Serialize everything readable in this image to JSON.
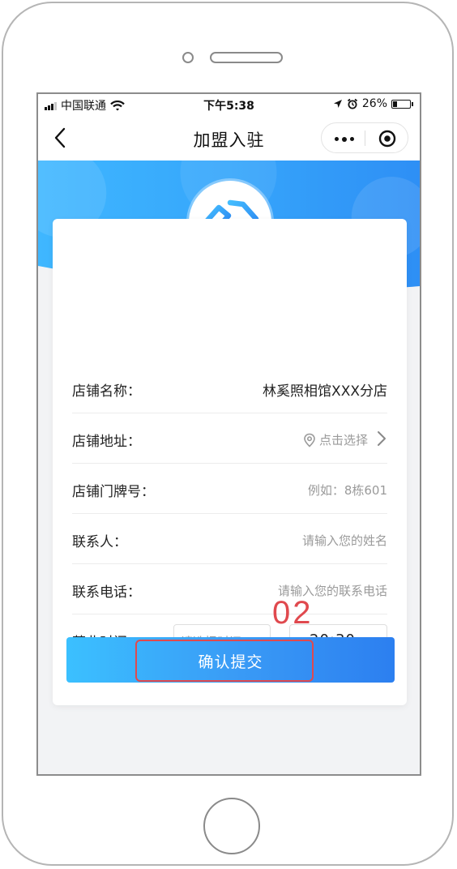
{
  "status_bar": {
    "carrier": "中国联通",
    "time": "下午5:38",
    "battery": "26%"
  },
  "nav": {
    "title": "加盟入驻"
  },
  "form": {
    "store_name": {
      "label": "店铺名称：",
      "value": "林奚照相馆XXX分店"
    },
    "store_address": {
      "label": "店铺地址：",
      "placeholder": "点击选择"
    },
    "door_number": {
      "label": "店铺门牌号：",
      "placeholder": "例如：8栋601"
    },
    "contact_person": {
      "label": "联系人：",
      "placeholder": "请输入您的姓名"
    },
    "contact_phone": {
      "label": "联系电话：",
      "placeholder": "请输入您的联系电话"
    },
    "business_hours": {
      "label": "营业时间：",
      "start_placeholder": "请选择时间",
      "end_value": "20:30"
    }
  },
  "annotation": {
    "number": "02"
  },
  "submit": {
    "label": "确认提交"
  },
  "colors": {
    "brand_blue": "#2e8ff5",
    "banner_light": "#3db2ff",
    "annotation_red": "#e0494e"
  }
}
